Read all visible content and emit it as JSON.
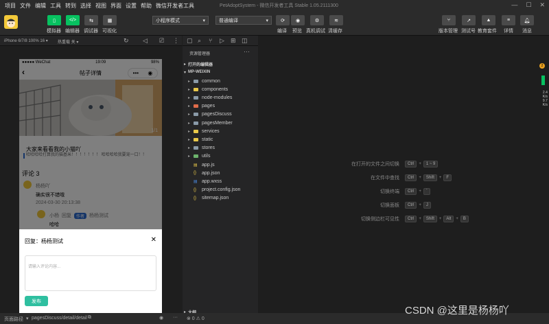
{
  "menu": {
    "items": [
      "项目",
      "文件",
      "编辑",
      "工具",
      "转到",
      "选择",
      "视图",
      "界面",
      "设置",
      "帮助",
      "微信开发者工具"
    ],
    "window_title": "PetAdoptSystem - 微信开发者工具 Stable 1.05.2111300"
  },
  "toolbar": {
    "simulator_label": "模拟器",
    "editor_label": "编辑器",
    "debugger_label": "调试器",
    "visual_label": "可视化",
    "mode_select": "小程序模式",
    "compile_select": "普通编译",
    "compile_label": "编译",
    "preview_label": "预览",
    "remote_debug_label": "真机调试",
    "clear_cache_label": "清缓存",
    "version_label": "版本管理",
    "test_label": "测试号",
    "edu_label": "教育套件",
    "details_label": "详情",
    "messages_label": "消息"
  },
  "simbar": {
    "device": "iPhone 6/7/8 100% 16 ▾",
    "hotreload": "热重载 关 ▾"
  },
  "phone": {
    "carrier": "●●●●● WeChat",
    "time": "19:09",
    "battery": "98%",
    "nav_title": "帖子详情",
    "image_counter": "1/1",
    "post_title": "大家来看看我的小猫吖",
    "post_body": "哈哈哈哈打算我的猫基米！！！！！！！ 哈哈哈哈我要宠一口！！",
    "comments_header": "评论 3",
    "comment1_user": "杨杨吖",
    "comment1_text": "确实很不错哦",
    "comment1_time": "2024-03-30 20:13:38",
    "reply_user": "小杨",
    "reply_word": "回复",
    "reply_tag": "作者",
    "reply_target": "杨杨测试",
    "reply_text": "哈哈",
    "sheet_title": "回复：杨杨测试",
    "textarea_placeholder": "请输入评论内容...",
    "publish_label": "发布"
  },
  "explorer": {
    "header": "资源管理器",
    "open_editors": "打开的编辑器",
    "project": "MP-WEIXIN",
    "outline": "大纲",
    "items": [
      {
        "name": "common",
        "type": "folder",
        "color": "#8a9aa8"
      },
      {
        "name": "components",
        "type": "folder",
        "color": "#e8c84a"
      },
      {
        "name": "node-modules",
        "type": "folder",
        "color": "#8a9aa8"
      },
      {
        "name": "pages",
        "type": "folder",
        "color": "#e06c4a"
      },
      {
        "name": "pagesDiscuss",
        "type": "folder",
        "color": "#8a9aa8"
      },
      {
        "name": "pagesMember",
        "type": "folder",
        "color": "#8a9aa8"
      },
      {
        "name": "services",
        "type": "folder",
        "color": "#e8c84a"
      },
      {
        "name": "static",
        "type": "folder",
        "color": "#e8c84a"
      },
      {
        "name": "stores",
        "type": "folder",
        "color": "#8a9aa8"
      },
      {
        "name": "utils",
        "type": "folder",
        "color": "#6cb36c"
      },
      {
        "name": "app.js",
        "type": "js",
        "color": "#e8c84a"
      },
      {
        "name": "app.json",
        "type": "json",
        "color": "#e8c84a"
      },
      {
        "name": "app.wxss",
        "type": "wxss",
        "color": "#4a8ae0"
      },
      {
        "name": "project.config.json",
        "type": "json",
        "color": "#e8c84a"
      },
      {
        "name": "sitemap.json",
        "type": "json",
        "color": "#e8c84a"
      }
    ]
  },
  "editor": {
    "hints": [
      {
        "label": "在打开的文件之间切换",
        "keys": [
          "Ctrl",
          "1 ~ 9"
        ]
      },
      {
        "label": "在文件中查找",
        "keys": [
          "Ctrl",
          "Shift",
          "F"
        ]
      },
      {
        "label": "切换终端",
        "keys": [
          "Ctrl",
          "`"
        ]
      },
      {
        "label": "切换面板",
        "keys": [
          "Ctrl",
          "J"
        ]
      },
      {
        "label": "切换侧边栏可见性",
        "keys": [
          "Ctrl",
          "Shift",
          "Alt",
          "B"
        ]
      }
    ],
    "side_badge": "2",
    "net_up": "2.4",
    "net_down": "9.7",
    "net_unit": "K/s"
  },
  "status": {
    "path_label": "页面路径",
    "path": "pagesDiscuss/detail/detail",
    "errors": "⊗ 0 ⚠ 0"
  },
  "watermark": "CSDN @这里是杨杨吖"
}
